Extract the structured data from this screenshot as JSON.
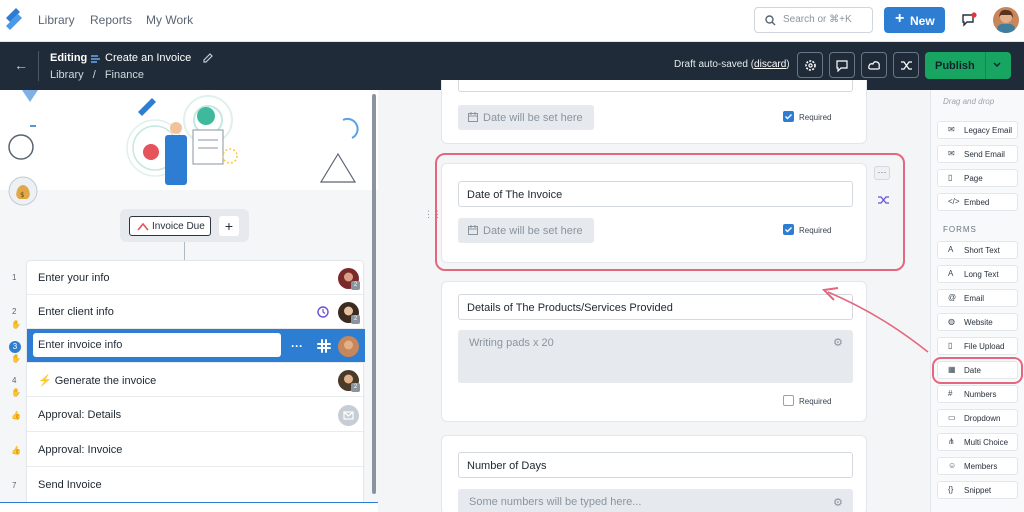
{
  "nav": {
    "links": [
      "Library",
      "Reports",
      "My Work"
    ],
    "search_placeholder": "Search or ⌘+K",
    "new_label": "New"
  },
  "editbar": {
    "editing_label": "Editing",
    "doc_title": "Create an Invoice",
    "breadcrumb_root": "Library",
    "breadcrumb_sep": "/",
    "breadcrumb_leaf": "Finance",
    "draft_text": "Draft auto-saved",
    "discard_label": "discard",
    "publish_label": "Publish"
  },
  "left": {
    "due_chip": "Invoice Due",
    "steps": [
      {
        "num": "1",
        "label": "Enter your info",
        "badge": "2"
      },
      {
        "num": "2",
        "label": "Enter client info",
        "badge": "2"
      },
      {
        "num": "3",
        "label": "Enter invoice info"
      },
      {
        "num": "4",
        "label": "⚡ Generate the invoice",
        "badge": "2"
      },
      {
        "num": "",
        "label": "Approval: Details"
      },
      {
        "num": "",
        "label": "Approval: Invoice"
      },
      {
        "num": "7",
        "label": "Send Invoice"
      }
    ]
  },
  "mid": {
    "date_placeholder": "Date will be set here",
    "required_label": "Required",
    "field_date_invoice": "Date of The Invoice",
    "field_products": "Details of The Products/Services Provided",
    "products_value": "Writing pads x 20",
    "field_days": "Number of Days",
    "days_placeholder": "Some numbers will be typed here..."
  },
  "right": {
    "drag_hint": "Drag and drop",
    "forms_heading": "FORMS",
    "content_widgets": [
      {
        "icon": "mail-icon",
        "label": "Legacy Email"
      },
      {
        "icon": "send-email-icon",
        "label": "Send Email"
      },
      {
        "icon": "page-icon",
        "label": "Page"
      },
      {
        "icon": "embed-icon",
        "label": "Embed"
      }
    ],
    "form_widgets": [
      {
        "icon": "text-icon",
        "label": "Short Text"
      },
      {
        "icon": "long-text-icon",
        "label": "Long Text"
      },
      {
        "icon": "at-icon",
        "label": "Email"
      },
      {
        "icon": "globe-icon",
        "label": "Website"
      },
      {
        "icon": "upload-icon",
        "label": "File Upload"
      },
      {
        "icon": "calendar-icon",
        "label": "Date"
      },
      {
        "icon": "numbers-icon",
        "label": "Numbers"
      },
      {
        "icon": "dropdown-icon",
        "label": "Dropdown"
      },
      {
        "icon": "multi-choice-icon",
        "label": "Multi Choice"
      },
      {
        "icon": "members-icon",
        "label": "Members"
      },
      {
        "icon": "snippet-icon",
        "label": "Snippet"
      }
    ]
  },
  "colors": {
    "accent": "#2d7dd2",
    "publish": "#18a562",
    "highlight": "#e4677f",
    "header": "#1f2b38"
  }
}
